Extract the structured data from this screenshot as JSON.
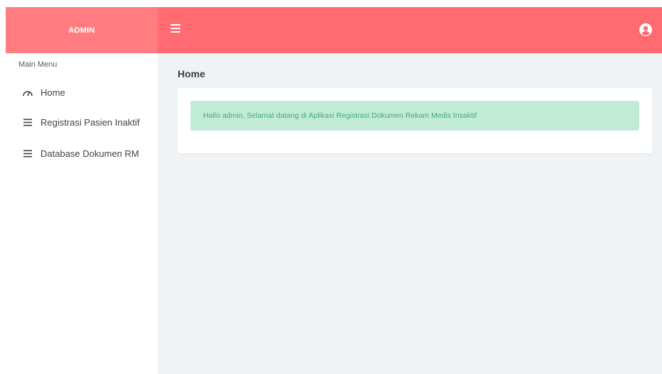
{
  "brand": {
    "title": "ADMIN"
  },
  "header": {
    "menu_toggle_icon": "hamburger-icon",
    "user_icon": "user-circle-icon",
    "color": "#ff6b70"
  },
  "sidebar": {
    "header": "Main Menu",
    "items": [
      {
        "label": "Home",
        "icon": "tachometer-icon"
      },
      {
        "label": "Registrasi Pasien Inaktif",
        "icon": "bars-icon"
      },
      {
        "label": "Database Dokumen RM",
        "icon": "bars-icon"
      }
    ]
  },
  "main": {
    "title": "Home",
    "alert": "Hallo admin, Selamat datang di Aplikasi Registrasi Dokumen Rekam Medis Insaktif"
  },
  "colors": {
    "brand_bg": "#ff7d80",
    "topbar_bg": "#ff6b70",
    "content_bg": "#f0f3f6",
    "alert_bg": "#c1ebd6",
    "alert_text": "#3eae77"
  }
}
